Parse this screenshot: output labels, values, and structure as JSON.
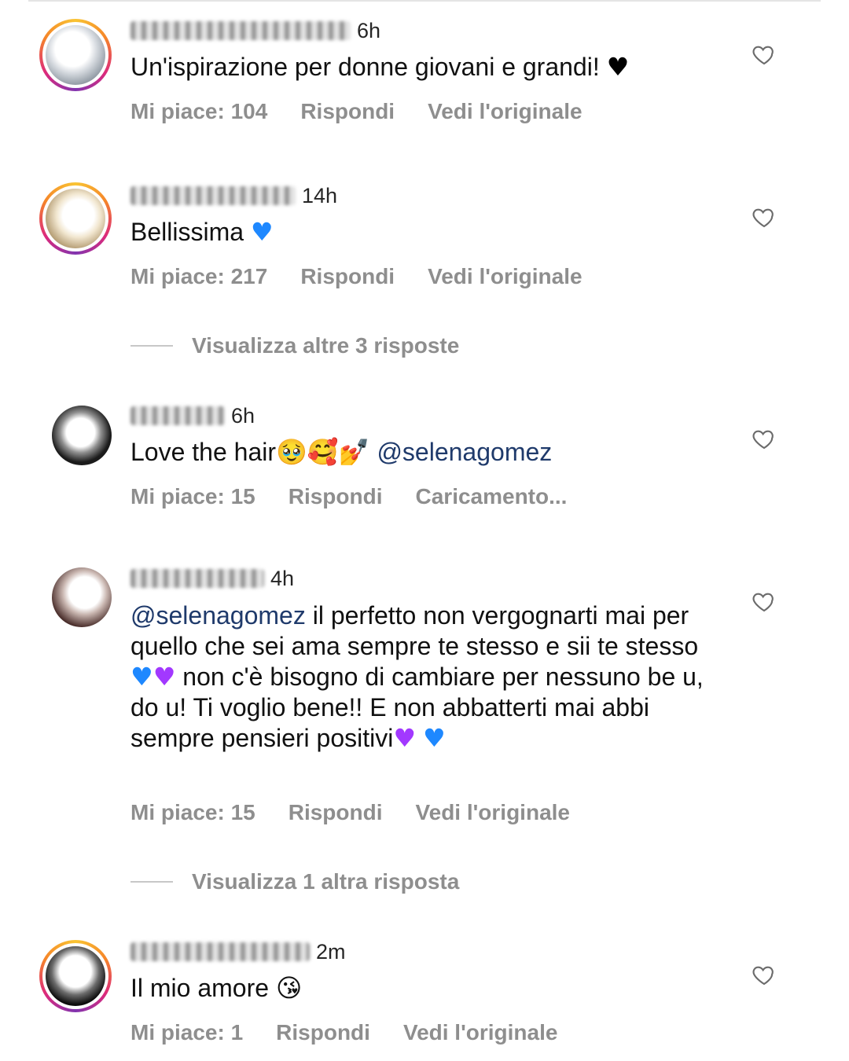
{
  "comments": [
    {
      "time": "6h",
      "text": "Un'ispirazione per donne giovani e grandi!",
      "emoji": "♥",
      "likes": "Mi piace: 104",
      "reply": "Rispondi",
      "third": "Vedi l'originale"
    },
    {
      "time": "14h",
      "text": "Bellissima",
      "emoji": "♥",
      "likes": "Mi piace: 217",
      "reply": "Rispondi",
      "third": "Vedi l'originale"
    },
    {
      "time": "6h",
      "text": "Love the hair",
      "emojis": "🥹🥰💅",
      "mention": "@selenagomez",
      "likes": "Mi piace: 15",
      "reply": "Rispondi",
      "third": "Caricamento..."
    },
    {
      "time": "4h",
      "mention": "@selenagomez",
      "text_a": " il perfetto non vergognarti mai per quello che sei ama sempre te stesso e sii te stesso ",
      "text_b": " non c'è bisogno di cambiare per nessuno be u, do u! Ti voglio bene!! E non abbatterti mai abbi sempre pensieri positivi",
      "heart_blue": "♥",
      "heart_purple": "♥",
      "likes": "Mi piace: 15",
      "reply": "Rispondi",
      "third": "Vedi l'originale"
    },
    {
      "time": "2m",
      "text": "Il mio amore",
      "emoji": "😘",
      "likes": "Mi piace: 1",
      "reply": "Rispondi",
      "third": "Vedi l'originale"
    }
  ],
  "replies_1": "Visualizza altre 3 risposte",
  "replies_2": "Visualizza 1 altra risposta",
  "icons": {
    "like": "heart-outline-icon"
  },
  "colors": {
    "mention": "#1f3a6b",
    "secondary_text": "#8e8e8e",
    "heart_blue": "#1e88ff",
    "heart_purple": "#a238ff"
  }
}
